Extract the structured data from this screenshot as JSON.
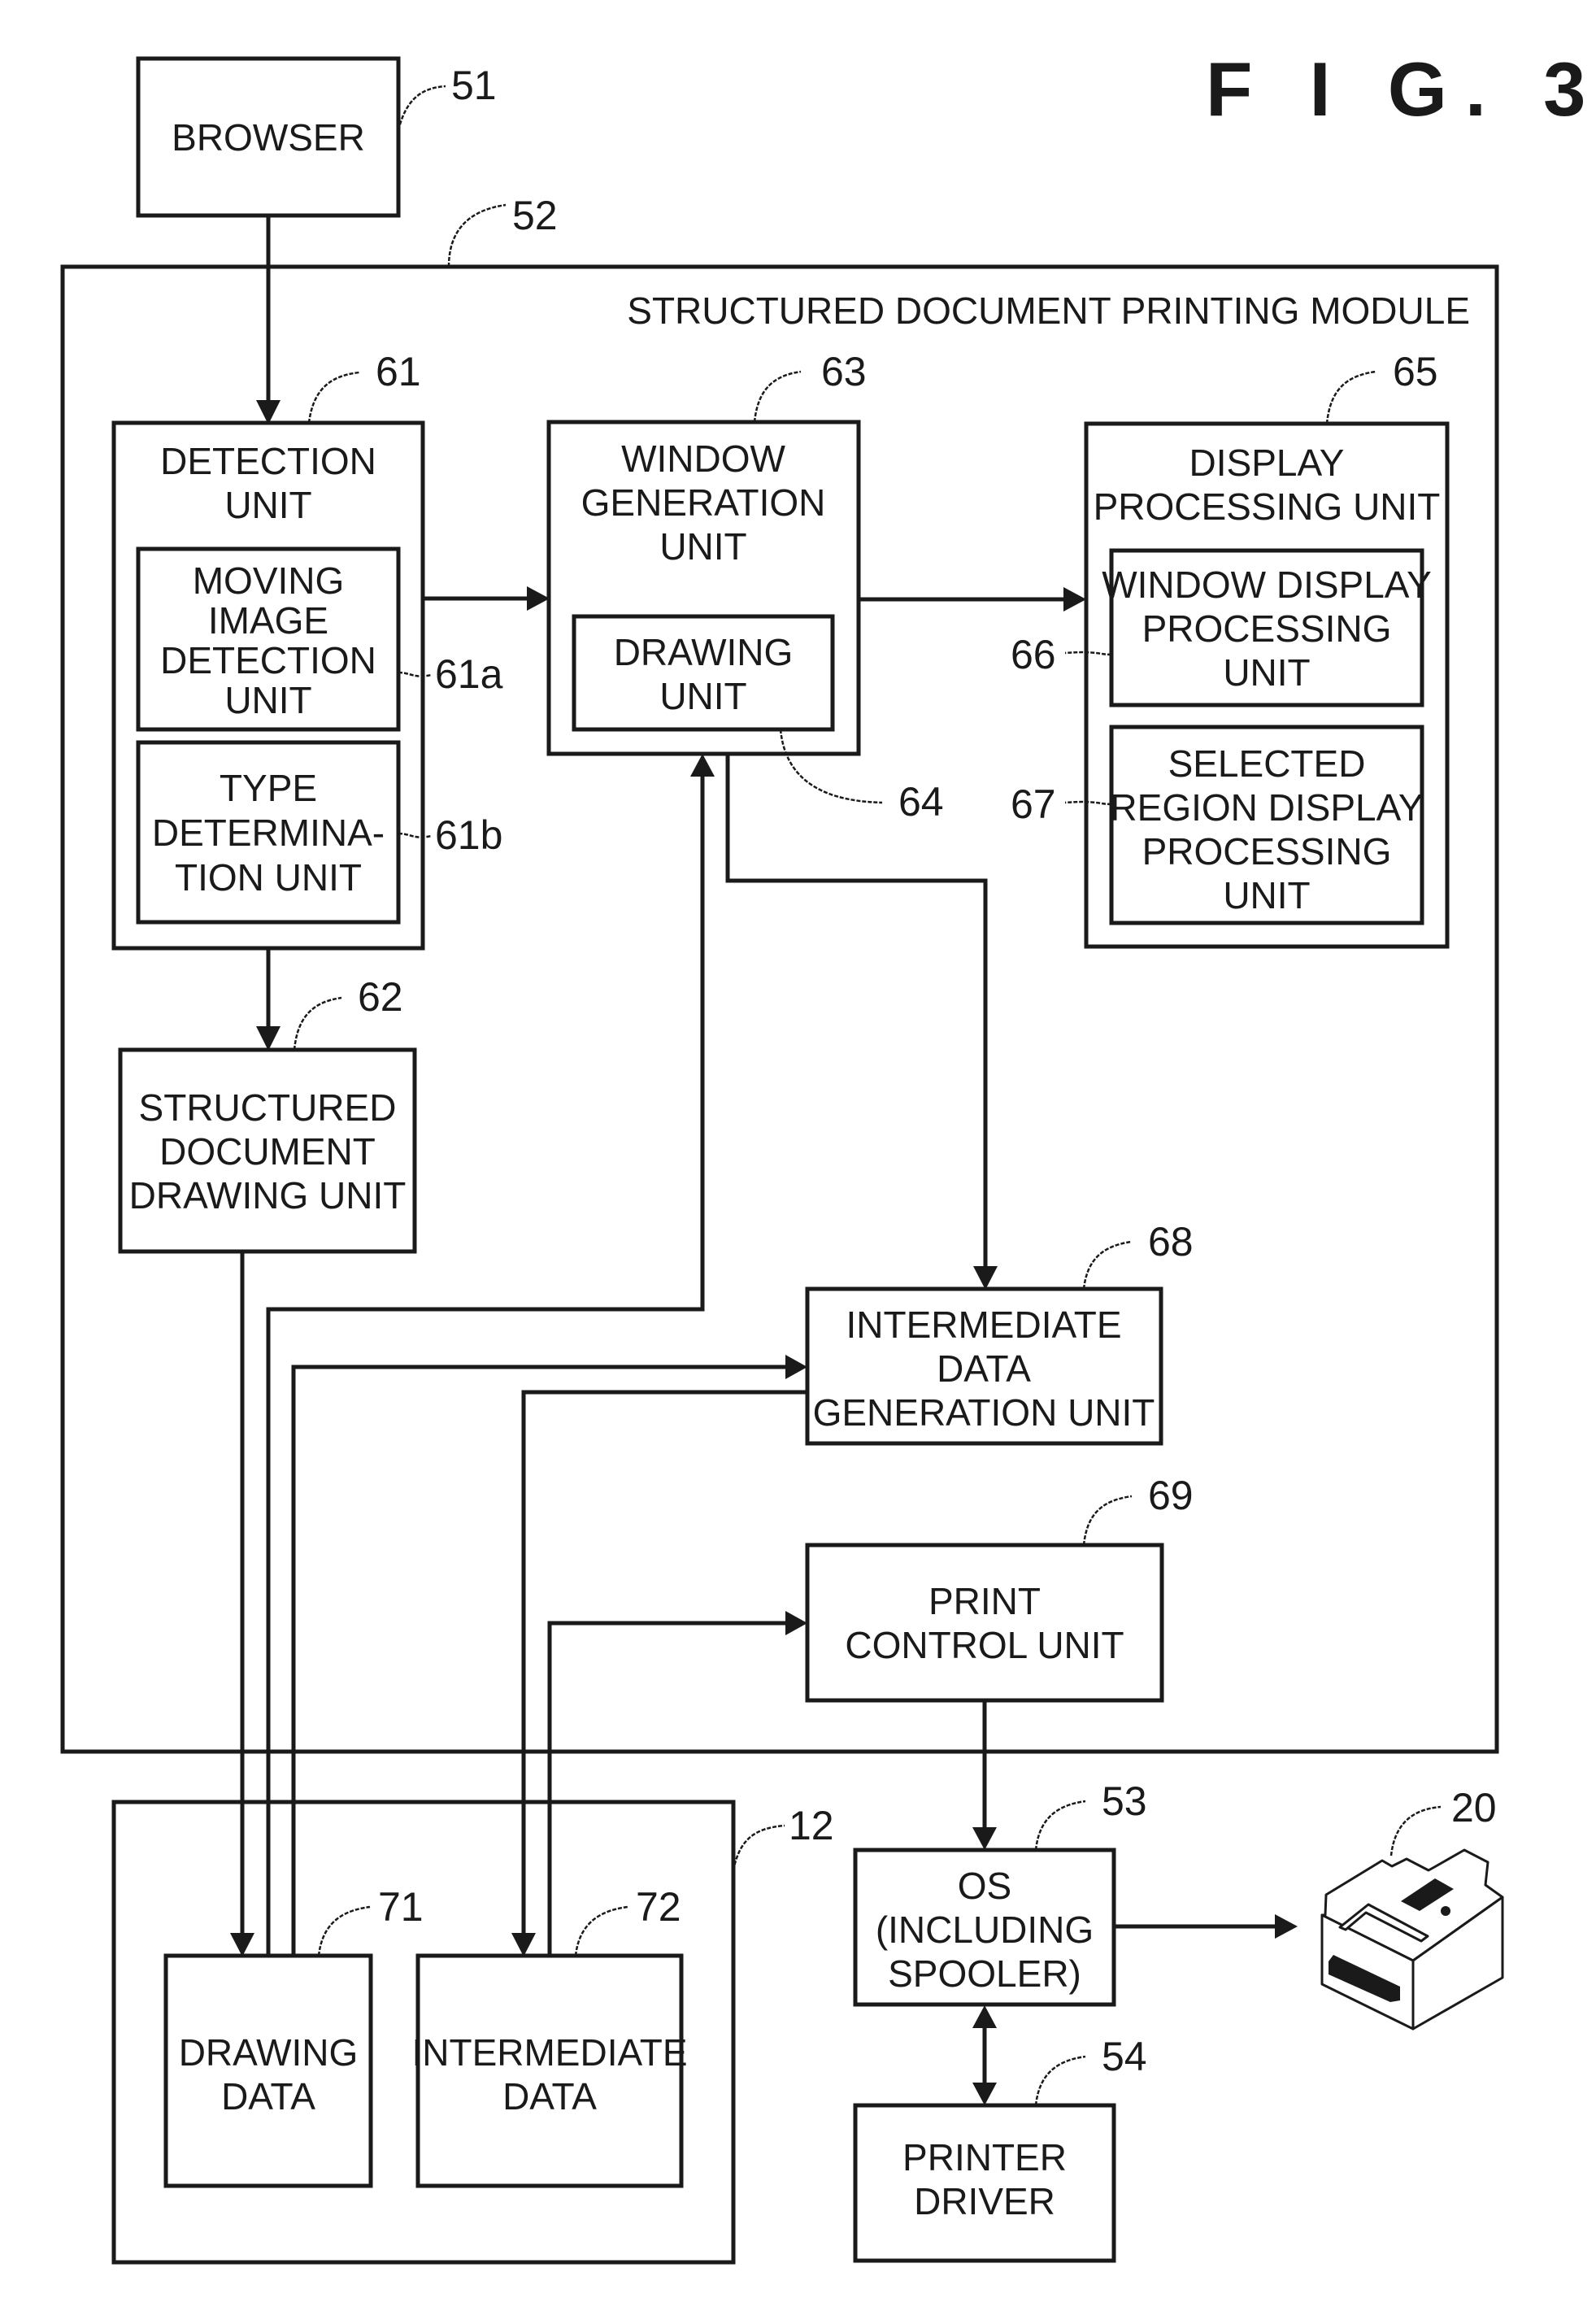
{
  "figure": {
    "title": "F I G. 3"
  },
  "module": {
    "title": "STRUCTURED DOCUMENT PRINTING MODULE",
    "ref": "52"
  },
  "boxes": {
    "browser": {
      "lines": [
        "BROWSER"
      ],
      "ref": "51"
    },
    "detection": {
      "lines": [
        "DETECTION",
        "UNIT"
      ],
      "ref": "61"
    },
    "moving_image": {
      "lines": [
        "MOVING",
        "IMAGE",
        "DETECTION",
        "UNIT"
      ],
      "ref": "61a"
    },
    "type_determination": {
      "lines": [
        "TYPE",
        "DETERMINA-",
        "TION UNIT"
      ],
      "ref": "61b"
    },
    "sd_drawing": {
      "lines": [
        "STRUCTURED",
        "DOCUMENT",
        "DRAWING UNIT"
      ],
      "ref": "62"
    },
    "window_generation": {
      "lines": [
        "WINDOW",
        "GENERATION",
        "UNIT"
      ],
      "ref": "63"
    },
    "drawing_unit": {
      "lines": [
        "DRAWING",
        "UNIT"
      ],
      "ref": "64"
    },
    "display_processing": {
      "lines": [
        "DISPLAY",
        "PROCESSING UNIT"
      ],
      "ref": "65"
    },
    "window_display": {
      "lines": [
        "WINDOW DISPLAY",
        "PROCESSING",
        "UNIT"
      ],
      "ref": "66"
    },
    "selected_region": {
      "lines": [
        "SELECTED",
        "REGION DISPLAY",
        "PROCESSING",
        "UNIT"
      ],
      "ref": "67"
    },
    "intermediate_gen": {
      "lines": [
        "INTERMEDIATE",
        "DATA",
        "GENERATION UNIT"
      ],
      "ref": "68"
    },
    "print_control": {
      "lines": [
        "PRINT",
        "CONTROL UNIT"
      ],
      "ref": "69"
    },
    "storage": {
      "lines": [],
      "ref": "12"
    },
    "drawing_data": {
      "lines": [
        "DRAWING",
        "DATA"
      ],
      "ref": "71"
    },
    "intermediate_data": {
      "lines": [
        "INTERMEDIATE",
        "DATA"
      ],
      "ref": "72"
    },
    "os": {
      "lines": [
        "OS",
        "(INCLUDING",
        "SPOOLER)"
      ],
      "ref": "53"
    },
    "printer_driver": {
      "lines": [
        "PRINTER",
        "DRIVER"
      ],
      "ref": "54"
    }
  },
  "printer": {
    "ref": "20",
    "icon": "printer-icon"
  }
}
